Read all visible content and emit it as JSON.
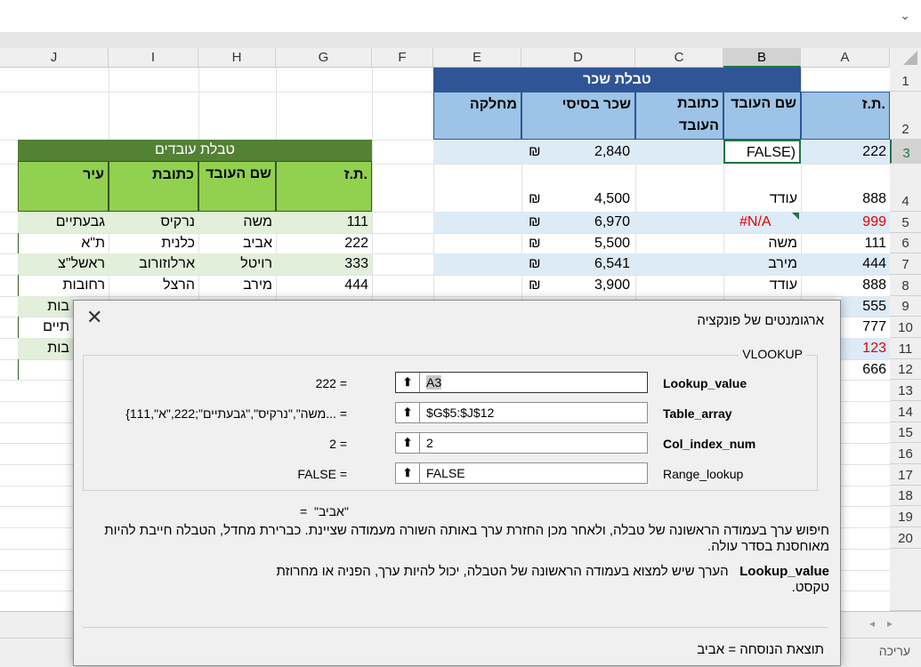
{
  "formula_bar": {
    "chevron": "⌄"
  },
  "columns": [
    "J",
    "I",
    "H",
    "G",
    "F",
    "E",
    "D",
    "C",
    "B",
    "A"
  ],
  "rows": [
    "1",
    "2",
    "3",
    "4",
    "5",
    "6",
    "7",
    "8",
    "9",
    "10",
    "11",
    "12",
    "13",
    "14",
    "15",
    "16",
    "17",
    "18",
    "19",
    "20"
  ],
  "salary_table": {
    "title": "טבלת שכר",
    "headers": {
      "id": "ת.ז.",
      "name": "שם העובד",
      "address": "כתובת העובד",
      "salary": "שכר בסיסי",
      "dept": "מחלקה"
    },
    "rows": [
      {
        "id": "222",
        "name": "FALSE)",
        "salary": "2,840"
      },
      {
        "id": "888",
        "name": "עודד",
        "salary": "4,500"
      },
      {
        "id": "999",
        "name": "#N/A",
        "salary": "6,970"
      },
      {
        "id": "111",
        "name": "משה",
        "salary": "5,500"
      },
      {
        "id": "444",
        "name": "מירב",
        "salary": "6,541"
      },
      {
        "id": "888",
        "name": "עודד",
        "salary": "3,900"
      },
      {
        "id": "555"
      },
      {
        "id": "777"
      },
      {
        "id": "123"
      },
      {
        "id": "666"
      }
    ],
    "currency": "₪"
  },
  "employees_table": {
    "title": "טבלת עובדים",
    "headers": {
      "id": "ת.ז.",
      "name": "שם העובד",
      "address": "כתובת",
      "city": "עיר"
    },
    "rows": [
      {
        "id": "111",
        "name": "משה",
        "address": "נרקיס",
        "city": "גבעתיים"
      },
      {
        "id": "222",
        "name": "אביב",
        "address": "כלנית",
        "city": "ת\"א"
      },
      {
        "id": "333",
        "name": "רויטל",
        "address": "ארלוזורוב",
        "city": "ראשל\"צ"
      },
      {
        "id": "444",
        "name": "מירב",
        "address": "הרצל",
        "city": "רחובות"
      }
    ],
    "partial_cities": [
      "בות",
      "תיים",
      "בות"
    ]
  },
  "dialog": {
    "title": "ארגומנטים של פונקציה",
    "function": "VLOOKUP",
    "args": [
      {
        "name": "Lookup_value",
        "value": "A3",
        "result": "222"
      },
      {
        "name": "Table_array",
        "value": "$G$5:$J$12",
        "result": "{111,\"משה\",\"נרקיס\",\"גבעתיים\";222,\"א..."
      },
      {
        "name": "Col_index_num",
        "value": "2",
        "result": "2"
      },
      {
        "name": "Range_lookup",
        "value": "FALSE",
        "result": "FALSE"
      }
    ],
    "equals": "=",
    "arg_button": "⬆",
    "overall_result": "\"אביב\"",
    "description": "חיפוש ערך בעמודה הראשונה של טבלה, ולאחר מכן החזרת ערך באותה השורה מעמודה שציינת. כברירת מחדל, הטבלה חייבת להיות מאוחסנת בסדר עולה.",
    "arg_help_name": "Lookup_value",
    "arg_help_text": "הערך שיש למצוא בעמודה הראשונה של הטבלה, יכול להיות ערך, הפניה או מחרוזת טקסט.",
    "formula_result_label": "תוצאת הנוסחה",
    "formula_result_value": "אביב"
  },
  "status_bar": {
    "mode": "עריכה"
  },
  "colors": {
    "blue_header": "#9dc3e6",
    "light_blue": "#ddebf7",
    "dark_green": "#548235",
    "green": "#92d050",
    "light_green": "#e2efda",
    "error_red": "#e00000"
  }
}
